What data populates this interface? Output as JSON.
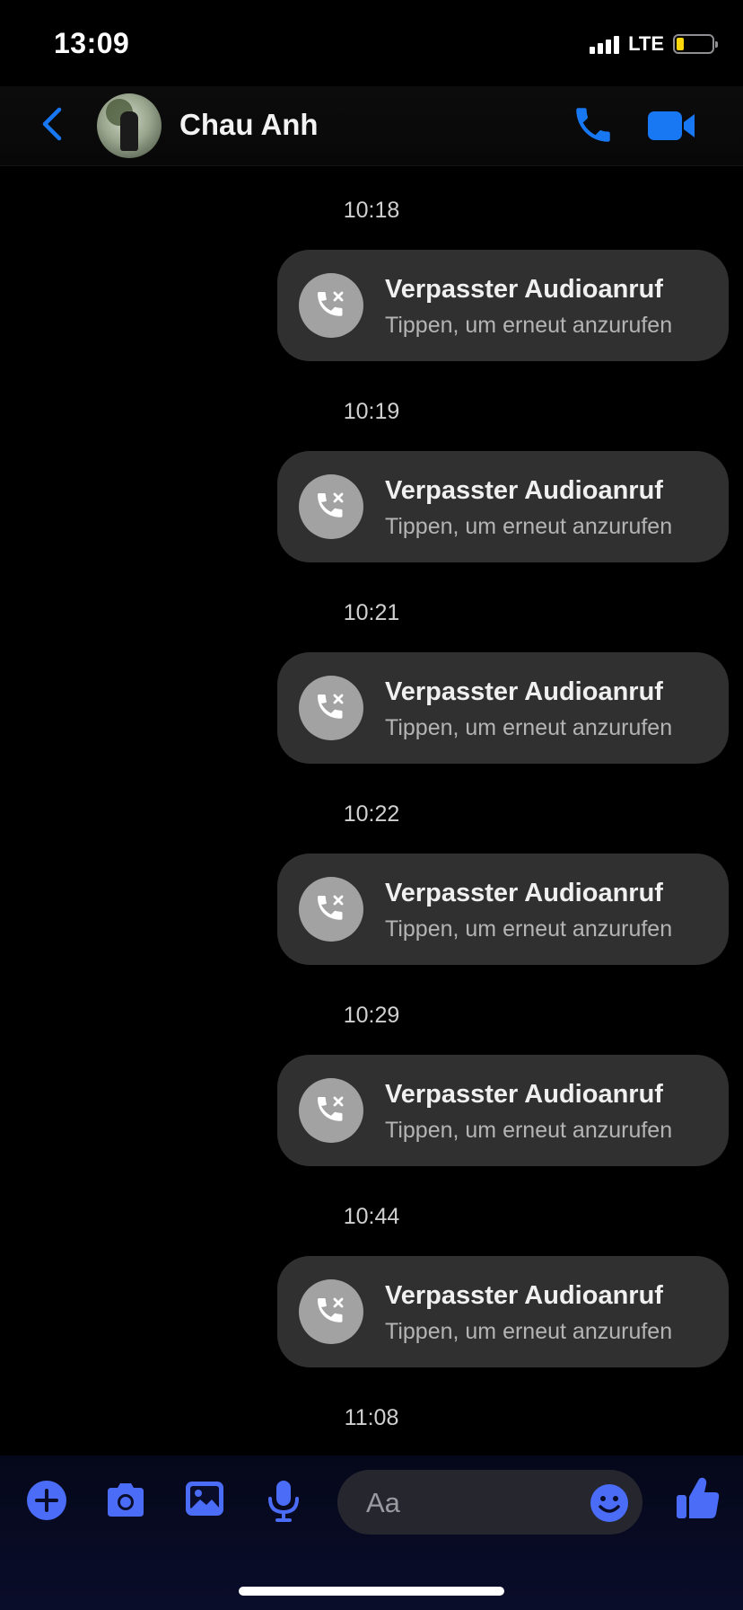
{
  "status_bar": {
    "time": "13:09",
    "network": "LTE",
    "battery_level": 0.2,
    "battery_color": "#ffd60a"
  },
  "header": {
    "back_icon": "chevron-left-icon",
    "contact_name": "Chau Anh",
    "call_icon": "phone-icon",
    "video_icon": "video-camera-icon",
    "accent_color": "#1877f2"
  },
  "messages": [
    {
      "time": "10:18",
      "title": "Verpasster Audioanruf",
      "subtitle": "Tippen, um erneut anzurufen",
      "icon": "missed-call-icon"
    },
    {
      "time": "10:19",
      "title": "Verpasster Audioanruf",
      "subtitle": "Tippen, um erneut anzurufen",
      "icon": "missed-call-icon"
    },
    {
      "time": "10:21",
      "title": "Verpasster Audioanruf",
      "subtitle": "Tippen, um erneut anzurufen",
      "icon": "missed-call-icon"
    },
    {
      "time": "10:22",
      "title": "Verpasster Audioanruf",
      "subtitle": "Tippen, um erneut anzurufen",
      "icon": "missed-call-icon"
    },
    {
      "time": "10:29",
      "title": "Verpasster Audioanruf",
      "subtitle": "Tippen, um erneut anzurufen",
      "icon": "missed-call-icon"
    },
    {
      "time": "10:44",
      "title": "Verpasster Audioanruf",
      "subtitle": "Tippen, um erneut anzurufen",
      "icon": "missed-call-icon"
    }
  ],
  "last_time": "11:08",
  "composer": {
    "placeholder": "Aa",
    "icons": [
      "plus-icon",
      "camera-icon",
      "image-icon",
      "microphone-icon",
      "emoji-icon",
      "thumbs-up-icon"
    ],
    "accent_color": "#4a6cf7"
  }
}
